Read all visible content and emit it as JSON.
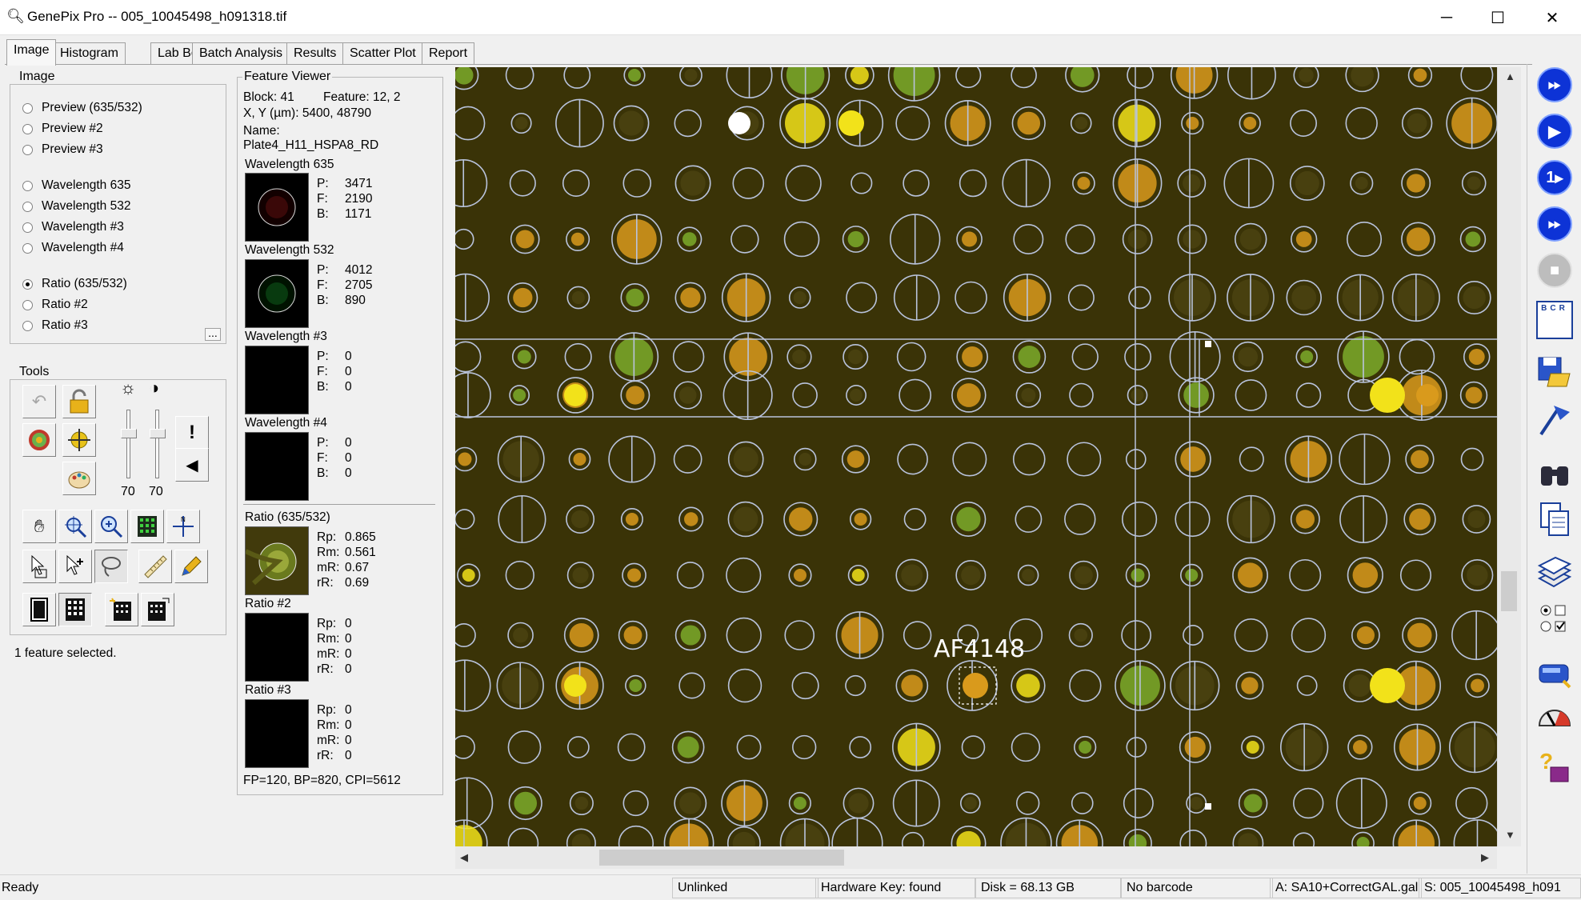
{
  "window": {
    "title": "GenePix Pro -- 005_10045498_h091318.tif",
    "minimize_glyph": "─",
    "maximize_glyph": "☐",
    "close_glyph": "✕"
  },
  "tabs": [
    "Image",
    "Histogram",
    "Lab Book",
    "Batch Analysis",
    "Results",
    "Scatter Plot",
    "Report"
  ],
  "image_group": {
    "title": "Image",
    "options": [
      {
        "label": "Preview (635/532)",
        "selected": false
      },
      {
        "label": "Preview #2",
        "selected": false
      },
      {
        "label": "Preview #3",
        "selected": false
      },
      {
        "label": "Wavelength 635",
        "selected": false
      },
      {
        "label": "Wavelength 532",
        "selected": false
      },
      {
        "label": "Wavelength #3",
        "selected": false
      },
      {
        "label": "Wavelength #4",
        "selected": false
      },
      {
        "label": "Ratio (635/532)",
        "selected": true
      },
      {
        "label": "Ratio #2",
        "selected": false
      },
      {
        "label": "Ratio #3",
        "selected": false
      }
    ],
    "more_button": "..."
  },
  "tools": {
    "title": "Tools",
    "brightness_value": "70",
    "contrast_value": "70",
    "status": "1 feature selected."
  },
  "feature_viewer": {
    "title": "Feature Viewer",
    "block": "Block: 41",
    "feature": "Feature:  12, 2",
    "xy": "X, Y (µm): 5400, 48790",
    "name_label": "Name:",
    "name": "Plate4_H11_HSPA8_RD",
    "wavelengths": [
      {
        "label": "Wavelength 635",
        "P": "3471",
        "F": "2190",
        "B": "1171",
        "ring": "#8a2020"
      },
      {
        "label": "Wavelength 532",
        "P": "4012",
        "F": "2705",
        "B": "890",
        "ring": "#1d6a2a"
      },
      {
        "label": "Wavelength #3",
        "P": "0",
        "F": "0",
        "B": "0",
        "ring": ""
      },
      {
        "label": "Wavelength #4",
        "P": "0",
        "F": "0",
        "B": "0",
        "ring": ""
      }
    ],
    "ratios": [
      {
        "label": "Ratio (635/532)",
        "Rp": "0.865",
        "Rm": "0.561",
        "mR": "0.67",
        "rR": "0.69"
      },
      {
        "label": "Ratio #2",
        "Rp": "0",
        "Rm": "0",
        "mR": "0",
        "rR": "0"
      },
      {
        "label": "Ratio #3",
        "Rp": "0",
        "Rm": "0",
        "mR": "0",
        "rR": "0"
      }
    ],
    "footer": "FP=120, BP=820, CPI=5612",
    "keys": {
      "P": "P:",
      "F": "F:",
      "B": "B:",
      "Rp": "Rp:",
      "Rm": "Rm:",
      "mR": "mR:",
      "rR": "rR:"
    }
  },
  "image": {
    "annotation": "AF4148",
    "colors": {
      "background": "#3a3307",
      "grid": "#b9c3dc",
      "yellow": "#f2e21a",
      "orange": "#d99a1c",
      "green": "#7cab2a"
    }
  },
  "right_toolbar": [
    "fast-forward-scan-icon",
    "play-scan-icon",
    "single-scan-icon",
    "batch-scan-icon",
    "stop-icon",
    "block-numbers-icon",
    "save-open-icon",
    "flag-icon",
    "binoculars-icon",
    "copy-icon",
    "stack-icon",
    "options-icon",
    "hardware-icon",
    "gauge-icon",
    "help-icon"
  ],
  "right_toolbar_text": {
    "single": "1",
    "blocks": "BCR"
  },
  "statusbar": {
    "ready": "Ready",
    "link": "Unlinked",
    "hardware": "Hardware Key: found",
    "disk": "Disk = 68.13 GB",
    "barcode": "No barcode",
    "gal": "A: SA10+CorrectGAL.gal",
    "scan": "S: 005_10045498_h091"
  }
}
